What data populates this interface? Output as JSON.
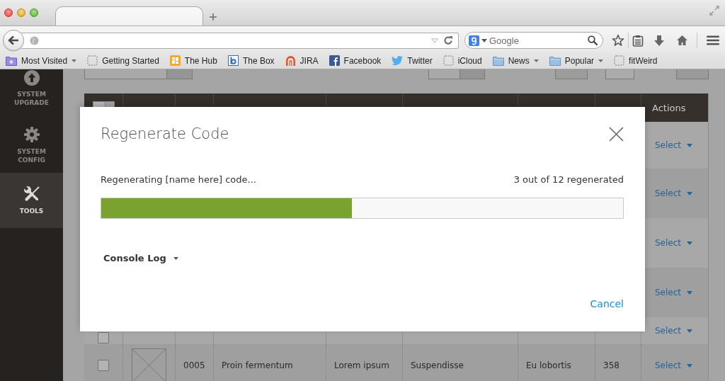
{
  "browser": {
    "search": {
      "placeholder": "Google"
    },
    "bookmarks": [
      {
        "label": "Most Visited",
        "kind": "smartfolder",
        "menu": true
      },
      {
        "label": "Getting Started",
        "kind": "blank",
        "menu": false
      },
      {
        "label": "The Hub",
        "kind": "tiles",
        "menu": false
      },
      {
        "label": "The Box",
        "kind": "squareb",
        "menu": false
      },
      {
        "label": "JIRA",
        "kind": "arches",
        "menu": false
      },
      {
        "label": "Facebook",
        "kind": "squaref",
        "menu": false
      },
      {
        "label": "Twitter",
        "kind": "bird",
        "menu": false
      },
      {
        "label": "iCloud",
        "kind": "blank",
        "menu": false
      },
      {
        "label": "News",
        "kind": "folder",
        "menu": true
      },
      {
        "label": "Popular",
        "kind": "folder",
        "menu": true
      },
      {
        "label": "fitWeird",
        "kind": "blank",
        "menu": false
      }
    ]
  },
  "sidebar": {
    "items": [
      {
        "label": "SYSTEM UPGRADE",
        "kind": "upgrade",
        "selected": false
      },
      {
        "label": "SYSTEM CONFIG",
        "kind": "config",
        "selected": false
      },
      {
        "label": "TOOLS",
        "kind": "tools",
        "selected": true
      }
    ]
  },
  "table": {
    "actions_heading": "Actions",
    "rows": [
      {
        "action": "Select"
      },
      {
        "action": "Select"
      },
      {
        "action": "Select"
      },
      {
        "action": "Select"
      },
      {
        "checked": false,
        "action": "Select"
      },
      {
        "checked": false,
        "image": true,
        "cells": [
          "0005",
          "Proin fermentum",
          "Lorem ipsum",
          "Suspendisse",
          "Eu lobortis",
          "358"
        ],
        "action": "Select"
      }
    ]
  },
  "dialog": {
    "title": "Regenerate Code",
    "status": "Regenerating [name here] code...",
    "count": "3 out of 12 regenerated",
    "progress": {
      "level": 0.48
    },
    "console_log": {
      "label": "Console Log",
      "expanded": false
    },
    "cancel": "Cancel"
  }
}
